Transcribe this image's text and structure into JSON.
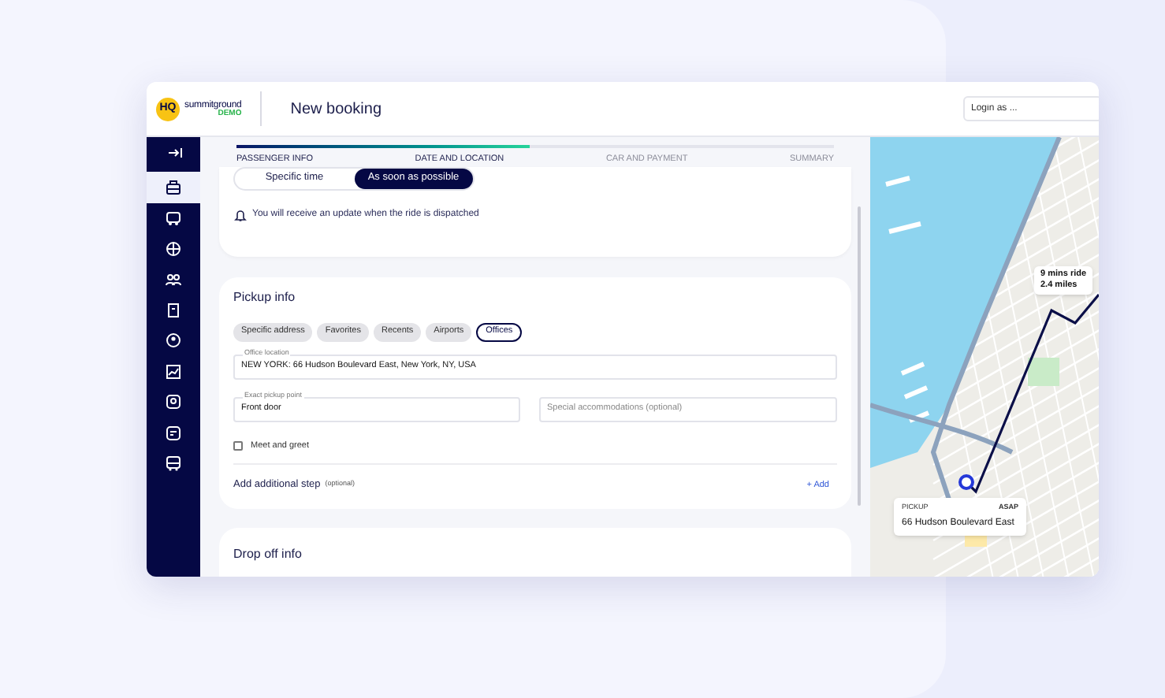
{
  "header": {
    "logo_mark": "HQ",
    "brand": "summitground",
    "brand_tag": "DEMO",
    "title": "New booking",
    "login": {
      "placeholder": "Login as ..."
    }
  },
  "sidebar": {
    "items": [
      {
        "kind": "collapse",
        "selected": false
      },
      {
        "kind": "nav",
        "selected": true
      },
      {
        "kind": "nav",
        "selected": false
      },
      {
        "kind": "nav",
        "selected": false
      },
      {
        "kind": "nav",
        "selected": false
      },
      {
        "kind": "nav",
        "selected": false
      },
      {
        "kind": "nav",
        "selected": false
      },
      {
        "kind": "nav",
        "selected": false
      },
      {
        "kind": "nav",
        "selected": false
      },
      {
        "kind": "nav",
        "selected": false
      },
      {
        "kind": "nav",
        "selected": false
      }
    ]
  },
  "stepper": {
    "level": 0.49,
    "steps": [
      {
        "label": "PASSENGER INFO",
        "reached": true
      },
      {
        "label": "DATE AND LOCATION",
        "reached": true
      },
      {
        "label": "CAR AND PAYMENT",
        "reached": false
      },
      {
        "label": "SUMMARY",
        "reached": false
      }
    ]
  },
  "timing": {
    "options": [
      {
        "label": "Specific time",
        "selected": false
      },
      {
        "label": "As soon as possible",
        "selected": true
      }
    ],
    "notice": "You will receive an update when the ride is dispatched"
  },
  "pickup": {
    "title": "Pickup info",
    "tabs": [
      {
        "label": "Specific address",
        "selected": false
      },
      {
        "label": "Favorites",
        "selected": false
      },
      {
        "label": "Recents",
        "selected": false
      },
      {
        "label": "Airports",
        "selected": false
      },
      {
        "label": "Offices",
        "selected": true
      }
    ],
    "office_location": {
      "label": "Office location",
      "value": "NEW YORK: 66 Hudson Boulevard East, New York, NY, USA"
    },
    "pickup_point": {
      "label": "Exact pickup point",
      "value": "Front door"
    },
    "accommodations": {
      "placeholder": "Special accommodations (optional)"
    },
    "meet_and_greet": {
      "label": "Meet and greet",
      "checked": false
    },
    "additional_step": {
      "label": "Add additional step",
      "note": "(optional)",
      "action": "+ Add"
    }
  },
  "dropoff": {
    "title": "Drop off info"
  },
  "map": {
    "ride_info": {
      "duration": "9 mins ride",
      "distance": "2.4 miles"
    },
    "pickup_card": {
      "label": "PICKUP",
      "timing": "ASAP",
      "address": "66 Hudson Boulevard East"
    }
  }
}
